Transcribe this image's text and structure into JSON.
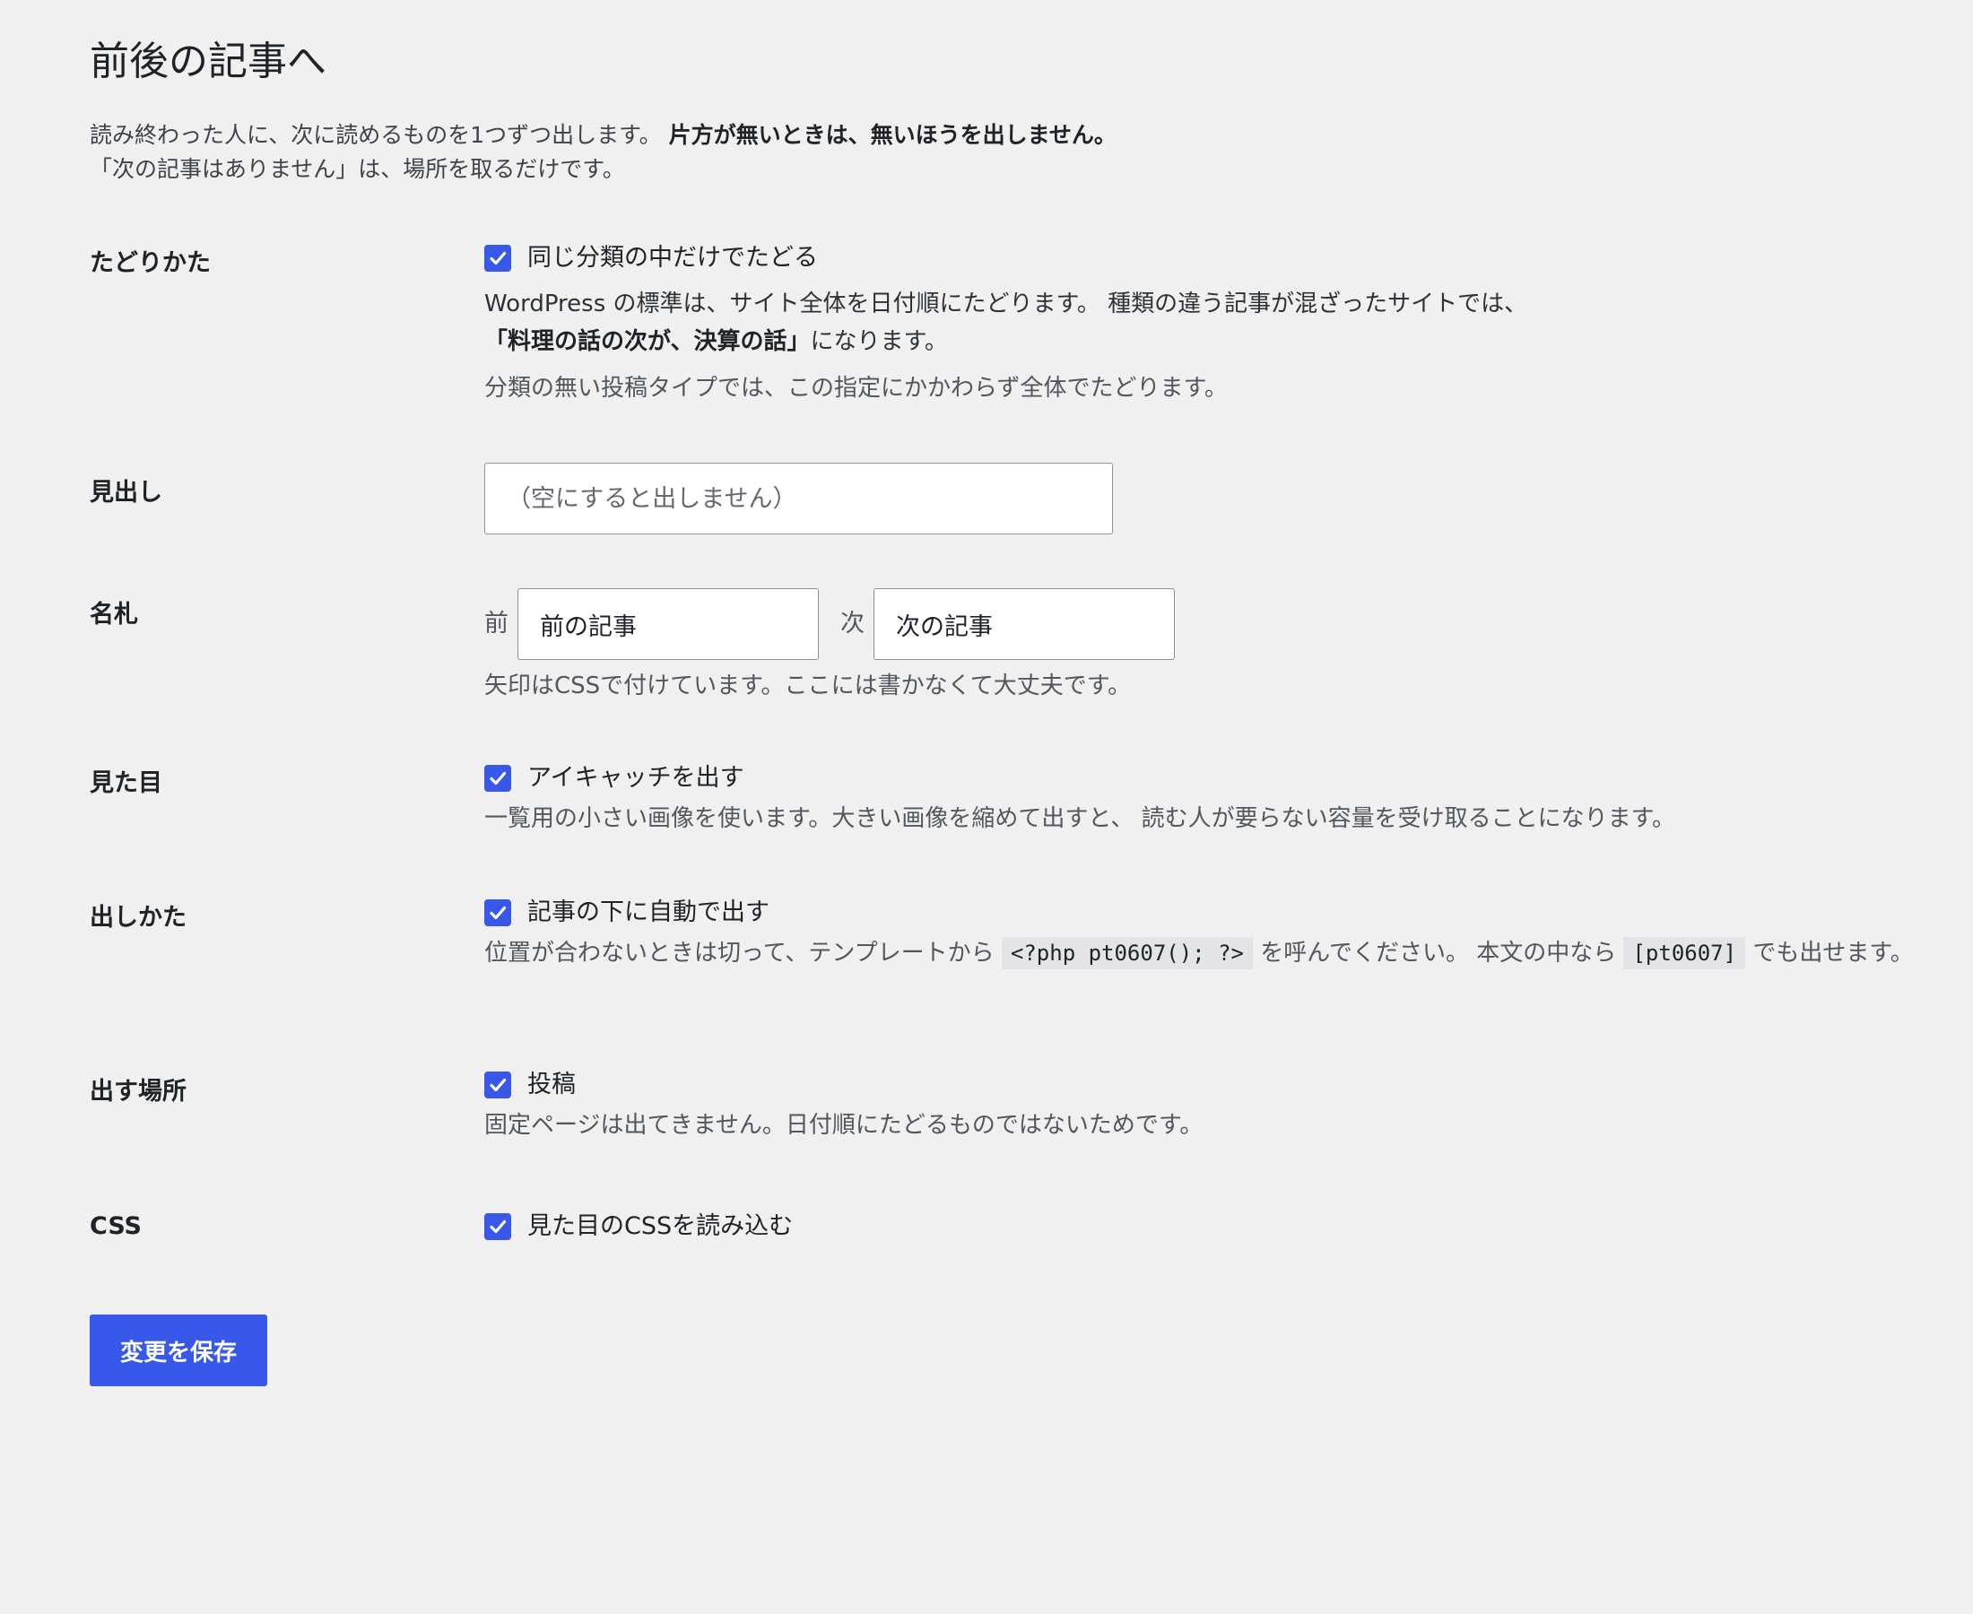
{
  "page": {
    "title": "前後の記事へ",
    "intro_line1": "読み終わった人に、次に読めるものを1つずつ出します。",
    "intro_line1_bold": "片方が無いときは、無いほうを出しません。",
    "intro_line2": "「次の記事はありません」は、場所を取るだけです。"
  },
  "taxonomy": {
    "label": "たどりかた",
    "checkbox_label": "同じ分類の中だけでたどる",
    "checked": true,
    "desc_line1": "WordPress の標準は、サイト全体を日付順にたどります。 種類の違う記事が混ざったサイトでは、",
    "desc_line2_bold": "「料理の話の次が、決算の話」",
    "desc_line2_tail": "になります。",
    "note": "分類の無い投稿タイプでは、この指定にかかわらず全体でたどります。"
  },
  "heading": {
    "label": "見出し",
    "value": "",
    "placeholder": "（空にすると出しません）"
  },
  "nametag": {
    "label": "名札",
    "prev_label": "前",
    "prev_value": "前の記事",
    "next_label": "次",
    "next_value": "次の記事",
    "desc": "矢印はCSSで付けています。ここには書かなくて大丈夫です。"
  },
  "appearance": {
    "label": "見た目",
    "checkbox_label": "アイキャッチを出す",
    "checked": true,
    "desc": "一覧用の小さい画像を使います。大きい画像を縮めて出すと、 読む人が要らない容量を受け取ることになります。"
  },
  "placement": {
    "label": "出しかた",
    "checkbox_label": "記事の下に自動で出す",
    "checked": true,
    "desc_before": "位置が合わないときは切って、テンプレートから",
    "code_php": "<?php pt0607(); ?>",
    "desc_middle": "を呼んでください。 本文の中なら",
    "code_shortcode": "[pt0607]",
    "desc_after": "でも出せます。"
  },
  "location": {
    "label": "出す場所",
    "checkbox_label": "投稿",
    "checked": true,
    "desc": "固定ページは出てきません。日付順にたどるものではないためです。"
  },
  "css": {
    "label": "CSS",
    "checkbox_label": "見た目のCSSを読み込む",
    "checked": true
  },
  "actions": {
    "save_label": "変更を保存"
  },
  "colors": {
    "accent": "#3858e9",
    "background": "#f0f0f1",
    "text": "#1d2327",
    "muted": "#50575e"
  }
}
